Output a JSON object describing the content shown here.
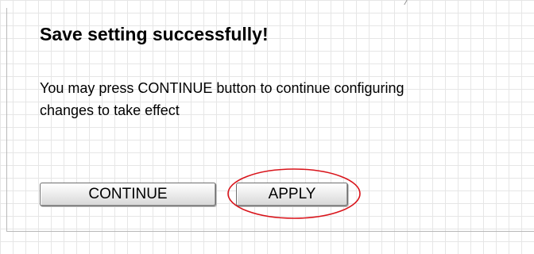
{
  "dialog": {
    "title": "Save setting successfully!",
    "message_line1": "You may press CONTINUE button to continue configuring",
    "message_line2": "changes to take effect"
  },
  "buttons": {
    "continue_label": "CONTINUE",
    "apply_label": "APPLY"
  },
  "annotation": {
    "highlight_color": "#d9141b",
    "highlighted_button": "APPLY"
  },
  "colors": {
    "background": "#ffffff",
    "grid_line": "#e6e6e6",
    "button_border": "#6e6e6e"
  }
}
